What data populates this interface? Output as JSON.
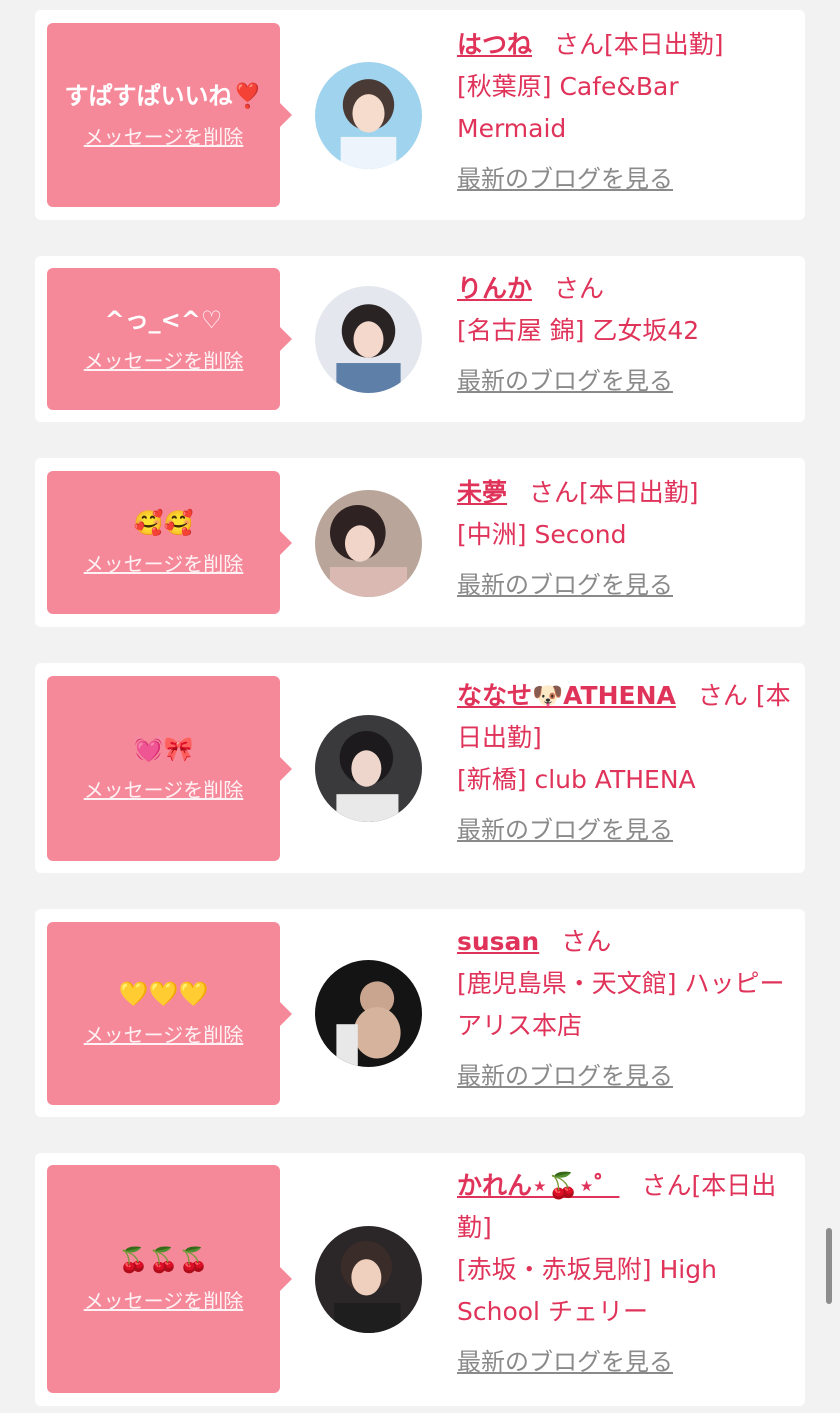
{
  "cards": [
    {
      "message": "すぱすぱいいね❣️",
      "delete_label": "メッセージを削除",
      "name": "はつね",
      "honorific": "さん[本日出勤]",
      "shop": "[秋葉原] Cafe&Bar Mermaid",
      "blog_label": "最新のブログを見る"
    },
    {
      "message": "^っ_<^♡",
      "delete_label": "メッセージを削除",
      "name": "りんか",
      "honorific": "さん",
      "shop": "[名古屋 錦] 乙女坂42",
      "blog_label": "最新のブログを見る"
    },
    {
      "message": "🥰🥰",
      "delete_label": "メッセージを削除",
      "name": "未夢",
      "honorific": "さん[本日出勤]",
      "shop": "[中洲] Second",
      "blog_label": "最新のブログを見る"
    },
    {
      "message": "💓🎀",
      "delete_label": "メッセージを削除",
      "name": "ななせ🐶ATHENA",
      "honorific": "さん [本日出勤]",
      "shop": "[新橋] club ATHENA",
      "blog_label": "最新のブログを見る"
    },
    {
      "message": "💛💛💛",
      "delete_label": "メッセージを削除",
      "name": "susan",
      "honorific": "さん",
      "shop": "[鹿児島県・天文館] ハッピーアリス本店",
      "blog_label": "最新のブログを見る"
    },
    {
      "message": "🍒🍒🍒",
      "delete_label": "メッセージを削除",
      "name": "かれん⋆🍒⋆゜",
      "honorific": "さん[本日出勤]",
      "shop": "[赤坂・赤坂見附] High School チェリー",
      "blog_label": "最新のブログを見る"
    }
  ]
}
